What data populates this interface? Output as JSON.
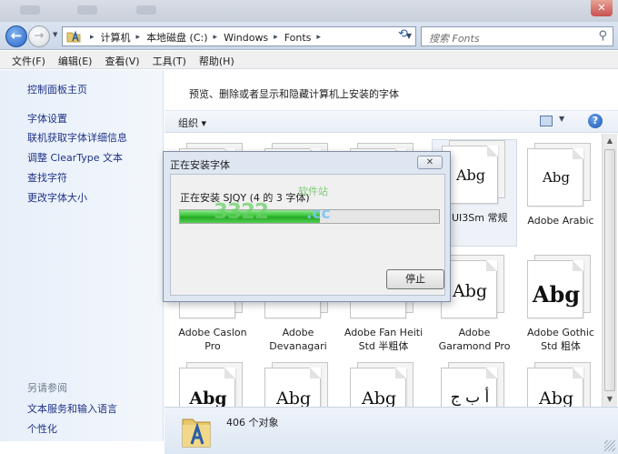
{
  "close_glyph": "✕",
  "nav": {
    "back_glyph": "←",
    "forward_glyph": "→",
    "breadcrumbs": [
      "计算机",
      "本地磁盘 (C:)",
      "Windows",
      "Fonts"
    ],
    "separator": "▸",
    "search_placeholder": "搜索 Fonts"
  },
  "menu": [
    "文件(F)",
    "编辑(E)",
    "查看(V)",
    "工具(T)",
    "帮助(H)"
  ],
  "left_pane": {
    "home_link": "控制面板主页",
    "links": [
      "字体设置",
      "联机获取字体详细信息",
      "调整 ClearType 文本",
      "查找字符",
      "更改字体大小"
    ],
    "see_also_heading": "另请参阅",
    "see_also": [
      "文本服务和输入语言",
      "个性化"
    ]
  },
  "header_text": "预览、删除或者显示和隐藏计算机上安装的字体",
  "toolbar": {
    "organize": "组织 ▾",
    "help": "?"
  },
  "tiles": [
    {
      "name": "",
      "sample": ""
    },
    {
      "name": "",
      "sample": ""
    },
    {
      "name": "",
      "sample": ""
    },
    {
      "name": "MUI3Sm 常规",
      "sample": "Abg"
    },
    {
      "name": "Adobe Arabic",
      "sample": "Abg"
    },
    {
      "name": "Adobe Caslon Pro",
      "sample": "Abg"
    },
    {
      "name": "Adobe Devanagari",
      "sample": "Abg"
    },
    {
      "name": "Adobe Fan Heiti Std 半粗体",
      "sample": "Abg"
    },
    {
      "name": "Adobe Garamond Pro",
      "sample": "Abg"
    },
    {
      "name": "Adobe Gothic Std 粗体",
      "sample": "Abg"
    },
    {
      "name": "",
      "sample": "Abg"
    },
    {
      "name": "",
      "sample": "Abg"
    },
    {
      "name": "",
      "sample": "Abg"
    },
    {
      "name": "",
      "sample": "أ ب ج"
    },
    {
      "name": "",
      "sample": "Abg"
    }
  ],
  "status": {
    "count": "406 个对象"
  },
  "dialog": {
    "title": "正在安装字体",
    "status": "正在安装 SJQY (4 的 3 字体)",
    "progress": 0.54,
    "stop_button": "停止",
    "close_glyph": "✕"
  },
  "watermark": {
    "a": "3322",
    "b": ".cc",
    "c": "软件站"
  }
}
